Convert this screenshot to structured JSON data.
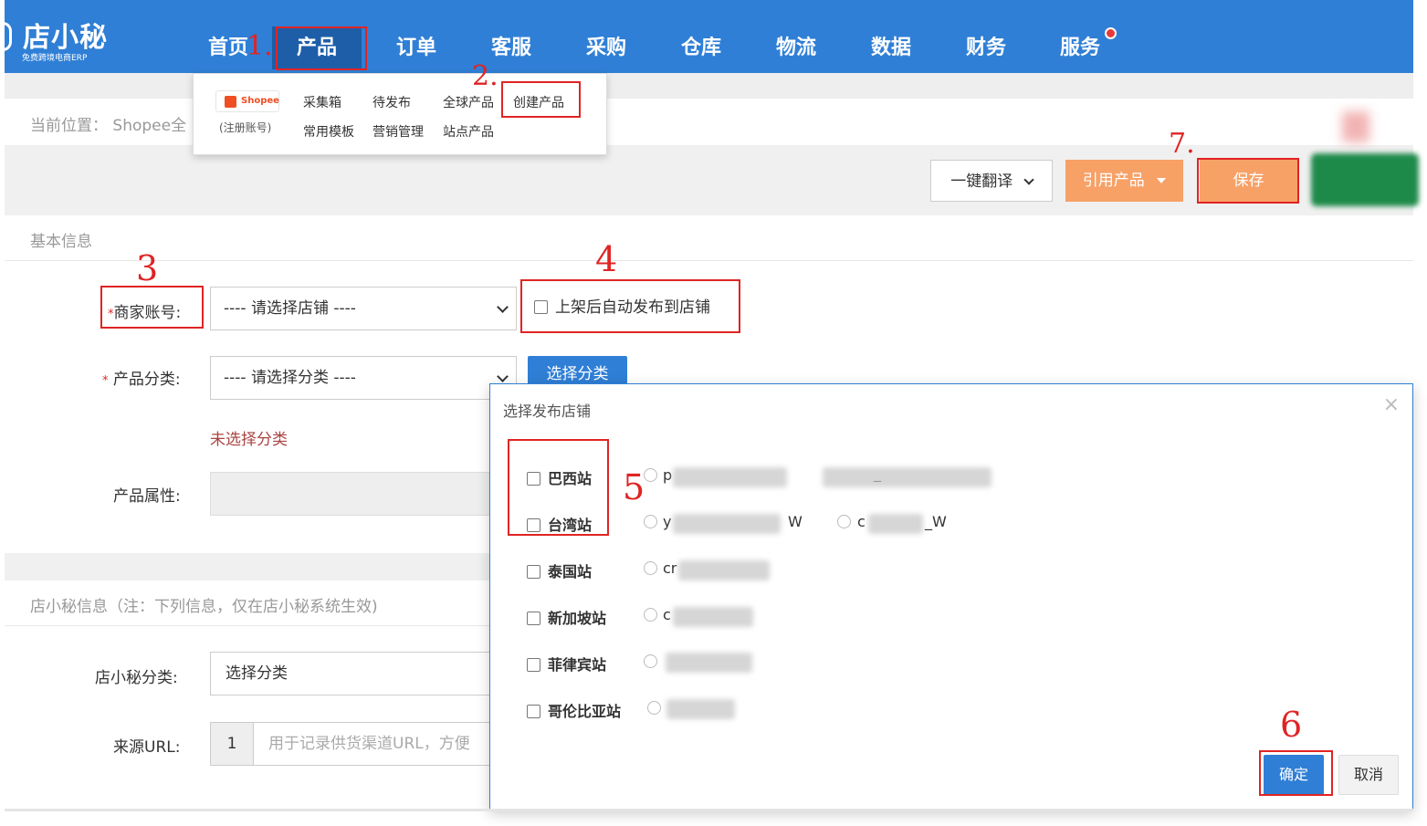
{
  "app": {
    "logo_text": "店小秘",
    "logo_subtitle": "免费跨境电商ERP"
  },
  "nav": {
    "items": [
      "首页",
      "产品",
      "订单",
      "客服",
      "采购",
      "仓库",
      "物流",
      "数据",
      "财务",
      "服务"
    ],
    "active": "产品"
  },
  "product_menu": {
    "platform": "Shopee",
    "platform_note": "(注册账号)",
    "links": [
      "采集箱",
      "待发布",
      "全球产品",
      "创建产品",
      "常用模板",
      "营销管理",
      "站点产品"
    ]
  },
  "breadcrumb": "当前位置： Shopee全",
  "toolbar": {
    "translate_label": "一键翻译",
    "cite_label": "引用产品",
    "save_label": "保存"
  },
  "basic_info": {
    "section_title": "基本信息",
    "merchant_label": "商家账号:",
    "merchant_placeholder": "---- 请选择店铺 ----",
    "auto_publish_label": "上架后自动发布到店铺",
    "category_label": "产品分类:",
    "category_placeholder": "---- 请选择分类 ----",
    "choose_category_btn": "选择分类",
    "no_category_text": "未选择分类",
    "attributes_label": "产品属性:"
  },
  "dxm_info": {
    "section_title": "店小秘信息（注：下列信息，仅在店小秘系统生效)",
    "category_label": "店小秘分类:",
    "category_value": "选择分类",
    "source_url_label": "来源URL:",
    "source_url_index": "1",
    "source_url_placeholder": "用于记录供货渠道URL，方便"
  },
  "modal": {
    "title": "选择发布店铺",
    "close_symbol": "×",
    "sites": [
      "巴西站",
      "台湾站",
      "泰国站",
      "新加坡站",
      "菲律宾站",
      "哥伦比亚站"
    ],
    "shop_fragments": [
      "p",
      "_",
      "y",
      "W",
      "c",
      "_W",
      "cr",
      "c"
    ],
    "confirm_label": "确定",
    "cancel_label": "取消"
  },
  "annotations": [
    "1.",
    "2.",
    "3",
    "4",
    "5",
    "6",
    "7."
  ],
  "colors": {
    "nav_bg": "#2f7fd6",
    "nav_active_bg": "#1e5ea8",
    "orange_button": "#f7a167",
    "annotation_red": "#e02424",
    "primary_blue": "#2f7fd6"
  }
}
